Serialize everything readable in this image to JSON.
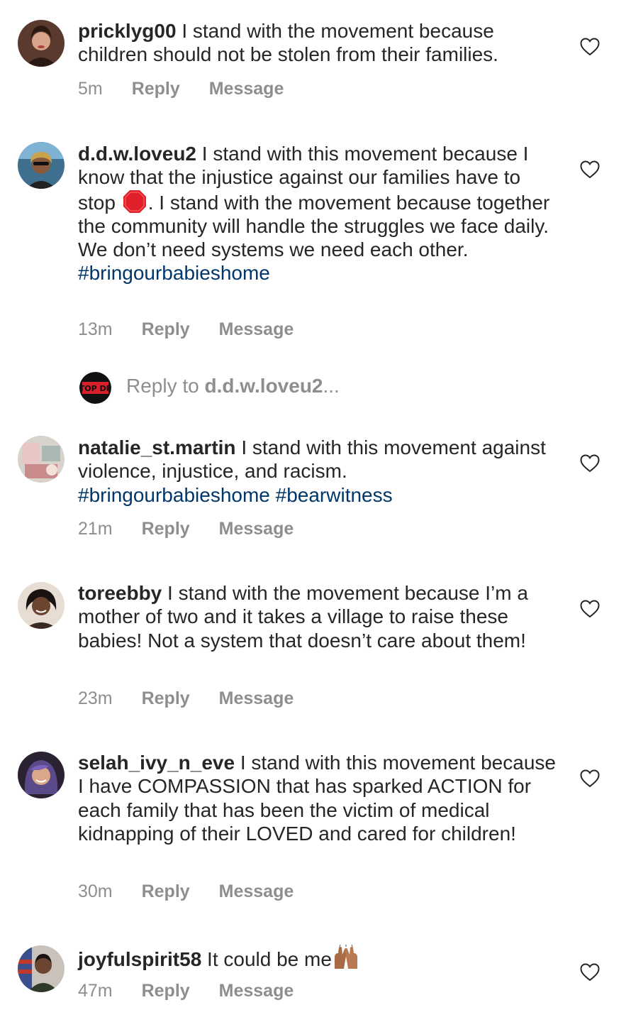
{
  "comments": [
    {
      "username": "pricklyg00",
      "text": "I stand with the movement because children should not be stolen from their families.",
      "time": "5m"
    },
    {
      "username": "d.d.w.loveu2",
      "text_part1": "I stand with this movement because I know that the injustice against our families have to stop ",
      "emoji": "stop-sign-emoji",
      "text_part2": ". I stand with the movement because together the community will handle the struggles we face daily.  We don’t need systems we need each other.",
      "hashtags": [
        "#bringourbabieshome"
      ],
      "time": "13m"
    },
    {
      "username": "natalie_st.martin",
      "text": "I stand with this movement against violence, injustice, and racism.",
      "hashtags": [
        "#bringourbabieshome",
        "#bearwitness"
      ],
      "time": "21m"
    },
    {
      "username": "toreebby",
      "text": "I stand with the movement because I’m a mother of two and it takes a village to raise these babies! Not a system that doesn’t care about them!",
      "time": "23m"
    },
    {
      "username": "selah_ivy_n_eve",
      "text": "I stand with this movement because I have COMPASSION that has sparked ACTION for each family that has been the victim of medical kidnapping of their LOVED and cared for children!",
      "time": "30m"
    },
    {
      "username": "joyfulspirit58",
      "text": "It could be me",
      "emoji": "raising-hands-emoji",
      "time": "47m"
    }
  ],
  "actions": {
    "reply": "Reply",
    "message": "Message"
  },
  "reply_box": {
    "prefix": "Reply to ",
    "username": "d.d.w.loveu2",
    "ellipsis": "...",
    "avatar_text": "STOP DFS"
  },
  "colors": {
    "text": "#262626",
    "meta": "#8e8e8e",
    "hashtag": "#00376b",
    "heart_stroke": "#262626",
    "stop_sign": "#e0202a"
  },
  "icons": {
    "like": "heart-outline-icon"
  }
}
